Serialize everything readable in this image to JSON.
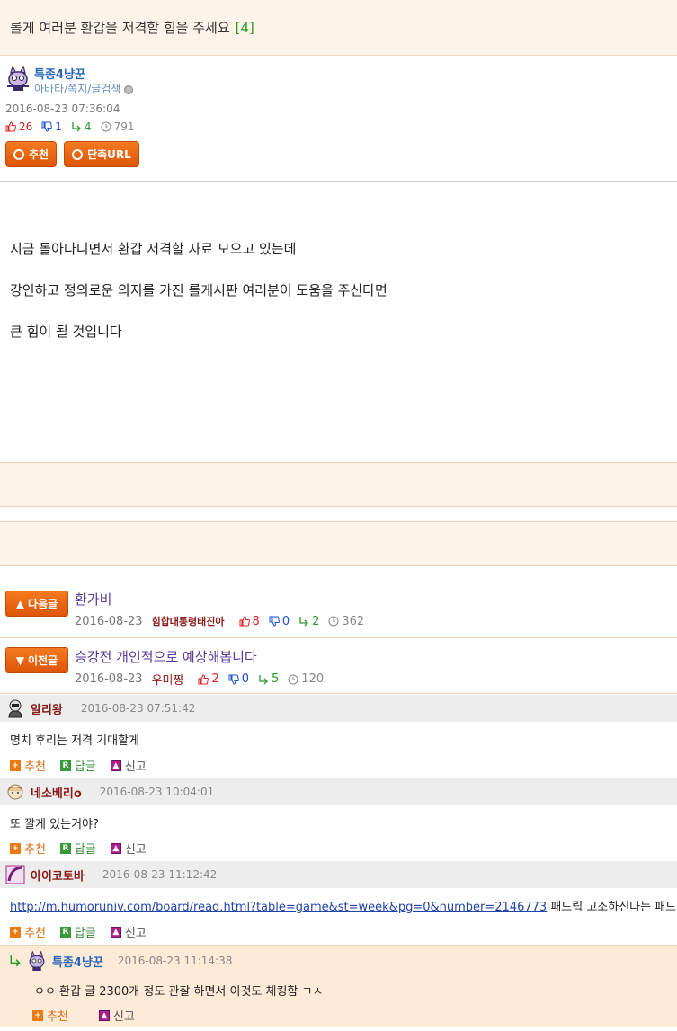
{
  "post": {
    "title": "롤게 여러분 환갑을 저격할 힘을 주세요",
    "comment_count": "[4]",
    "author": "특종4냥꾼",
    "author_links": "아바타/쪽지/글검색",
    "date": "2016-08-23 07:36:04",
    "up": "26",
    "down": "1",
    "reply": "4",
    "views": "791",
    "recommend_label": "추천",
    "short_url_label": "단축URL",
    "content": [
      "지금 돌아다니면서 환갑 저격할 자료 모으고 있는데",
      "강인하고 정의로운 의지를 가진 롤게시판 여러분이 도움을 주신다면",
      "큰 힘이 될 것입니다"
    ]
  },
  "nav": {
    "next": {
      "label": "다음글",
      "title": "환가비",
      "date": "2016-08-23",
      "author": "힘합대통령태진아",
      "up": "8",
      "down": "0",
      "reply": "2",
      "views": "362"
    },
    "prev": {
      "label": "이전글",
      "title": "승강전 개인적으로 예상해봅니다",
      "date": "2016-08-23",
      "author": "우미쨩",
      "up": "2",
      "down": "0",
      "reply": "5",
      "views": "120"
    }
  },
  "actions": {
    "recommend": "추천",
    "reply": "답글",
    "report": "신고"
  },
  "comments": [
    {
      "name": "알리왕",
      "date": "2016-08-23 07:51:42",
      "text": "명치 후리는 저격 기대할게"
    },
    {
      "name": "네소베리o",
      "date": "2016-08-23 10:04:01",
      "text": "또 깔게 있는거야?"
    },
    {
      "name": "아이코토바",
      "date": "2016-08-23 11:12:42",
      "link": "http://m.humoruniv.com/board/read.html?table=game&st=week&pg=0&number=2146773",
      "text": " 패드립 고소하신다는 패드립러"
    }
  ],
  "reply_comment": {
    "name": "특종4냥꾼",
    "date": "2016-08-23 11:14:38",
    "text": "ㅇㅇ 환갑 글 2300개 정도 관찰 하면서 이것도 체킹함 ㄱㅅ"
  },
  "colors": {
    "accent_orange": "#e8650f",
    "header_bg": "#fdf3e8",
    "up_red": "#d82020",
    "down_blue": "#1a4fd0",
    "reply_green": "#2a9a2a"
  }
}
